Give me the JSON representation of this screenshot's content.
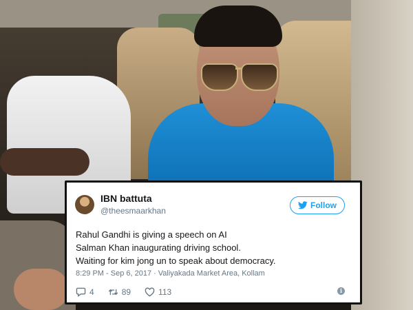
{
  "tweet": {
    "display_name": "IBN battuta",
    "handle": "@theesmaarkhan",
    "follow_label": "Follow",
    "lines": [
      "Rahul Gandhi is giving a speech on AI",
      "Salman Khan inaugurating driving school.",
      "Waiting for kim jong un to speak about democracy."
    ],
    "time": "8:29 PM - Sep 6, 2017",
    "separator": "·",
    "location": "Valiyakada Market Area, Kollam",
    "replies": "4",
    "retweets": "89",
    "likes": "113"
  },
  "colors": {
    "accent": "#1da1f2",
    "muted": "#657786",
    "text": "#14171a"
  },
  "icons": {
    "follow": "twitter-bird-icon",
    "reply": "reply-icon",
    "retweet": "retweet-icon",
    "like": "heart-icon",
    "info": "info-icon"
  }
}
